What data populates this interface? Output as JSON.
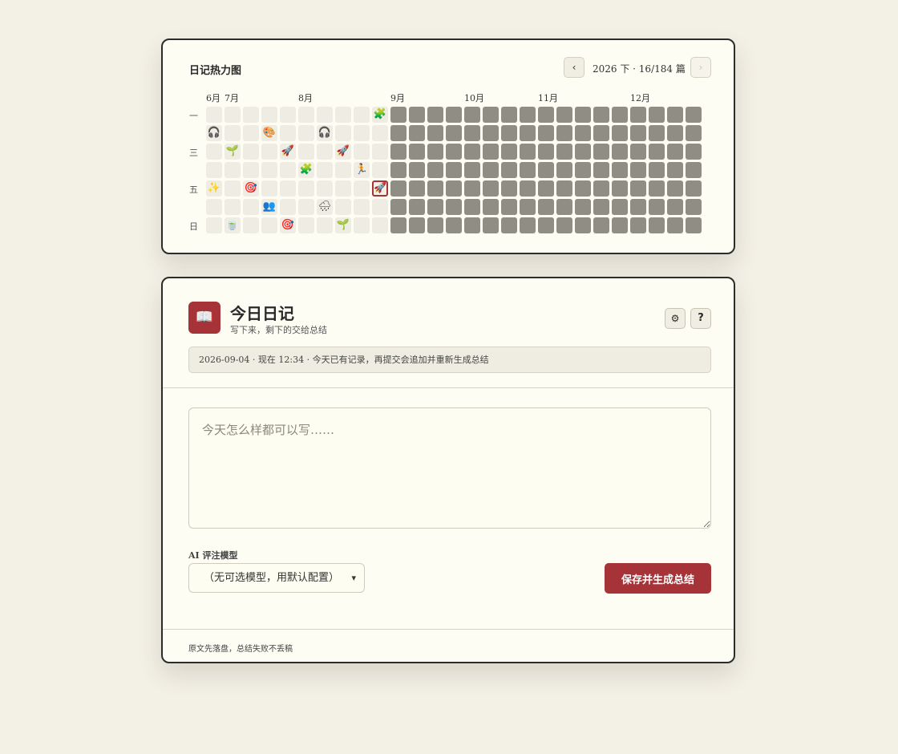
{
  "heatmap": {
    "title": "日记热力图",
    "range_label": "2026 下 · 16/184 篇",
    "prev_icon": "‹",
    "next_icon": "›",
    "months": [
      {
        "label": "6月",
        "week": 0
      },
      {
        "label": "7月",
        "week": 1
      },
      {
        "label": "8月",
        "week": 5
      },
      {
        "label": "9月",
        "week": 10
      },
      {
        "label": "10月",
        "week": 14
      },
      {
        "label": "11月",
        "week": 18
      },
      {
        "label": "12月",
        "week": 23
      }
    ],
    "weekdays": [
      {
        "label": "一",
        "row": 0
      },
      {
        "label": "三",
        "row": 2
      },
      {
        "label": "五",
        "row": 4
      },
      {
        "label": "日",
        "row": 6
      }
    ],
    "weeks": 27,
    "future_from_week": 10,
    "today": {
      "week": 9,
      "day": 4
    },
    "entries": [
      {
        "week": 9,
        "day": 0,
        "emoji": "🧩"
      },
      {
        "week": 0,
        "day": 1,
        "emoji": "🎧"
      },
      {
        "week": 3,
        "day": 1,
        "emoji": "🎨"
      },
      {
        "week": 6,
        "day": 1,
        "emoji": "🎧"
      },
      {
        "week": 1,
        "day": 2,
        "emoji": "🌱"
      },
      {
        "week": 4,
        "day": 2,
        "emoji": "🚀"
      },
      {
        "week": 7,
        "day": 2,
        "emoji": "🚀"
      },
      {
        "week": 5,
        "day": 3,
        "emoji": "🧩"
      },
      {
        "week": 8,
        "day": 3,
        "emoji": "🏃"
      },
      {
        "week": 0,
        "day": 4,
        "emoji": "✨"
      },
      {
        "week": 2,
        "day": 4,
        "emoji": "🎯"
      },
      {
        "week": 9,
        "day": 4,
        "emoji": "🚀"
      },
      {
        "week": 3,
        "day": 5,
        "emoji": "👥"
      },
      {
        "week": 6,
        "day": 5,
        "emoji": "🌧"
      },
      {
        "week": 1,
        "day": 6,
        "emoji": "🍵"
      },
      {
        "week": 4,
        "day": 6,
        "emoji": "🎯"
      },
      {
        "week": 7,
        "day": 6,
        "emoji": "🌱"
      }
    ]
  },
  "diary": {
    "logo_icon": "📖",
    "title": "今日日记",
    "subtitle": "写下来，剩下的交给总结",
    "settings_icon": "⚙",
    "help_icon": "?",
    "status": "2026-09-04 · 现在 12:34 · 今天已有记录，再提交会追加并重新生成总结",
    "textarea_placeholder": "今天怎么样都可以写……",
    "textarea_value": "",
    "model_label": "AI 评注模型",
    "model_selected": "（无可选模型，用默认配置）",
    "save_label": "保存并生成总结",
    "footer": "原文先落盘，总结失败不丢稿"
  },
  "colors": {
    "accent": "#a63338",
    "empty_cell": "#eeece3",
    "future_cell": "#8f8d84",
    "card_bg": "#fefdf4",
    "page_bg": "#f3f0e6"
  }
}
